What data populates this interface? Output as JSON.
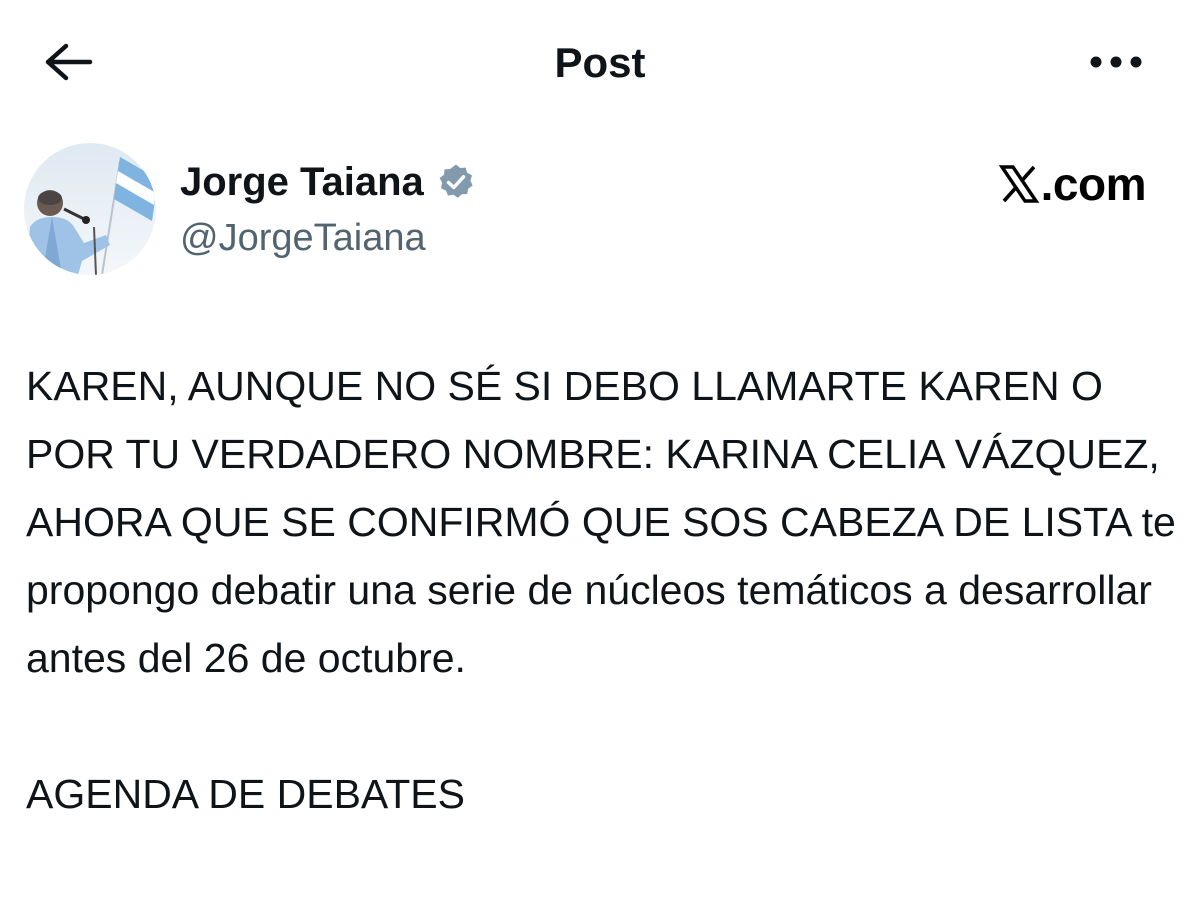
{
  "header": {
    "title": "Post",
    "back_icon": "arrow-left-icon",
    "more_icon": "more-horizontal-icon"
  },
  "author": {
    "name": "Jorge Taiana",
    "handle": "@JorgeTaiana",
    "verified": true,
    "verified_color": "#829aab",
    "avatar_icon": "profile-photo"
  },
  "watermark": {
    "text": ".com",
    "logo_icon": "x-logo-icon"
  },
  "post": {
    "paragraph_1": "KAREN, AUNQUE NO SÉ SI DEBO LLAMARTE KAREN O POR TU VERDADERO NOMBRE: KARINA CELIA VÁZQUEZ, AHORA QUE SE CONFIRMÓ QUE SOS CABEZA DE LISTA te propongo debatir una serie de núcleos temáticos a desarrollar antes del 26 de octubre.",
    "paragraph_2": "AGENDA DE DEBATES"
  },
  "colors": {
    "text_primary": "#0f1419",
    "text_secondary": "#536471",
    "background": "#ffffff"
  }
}
